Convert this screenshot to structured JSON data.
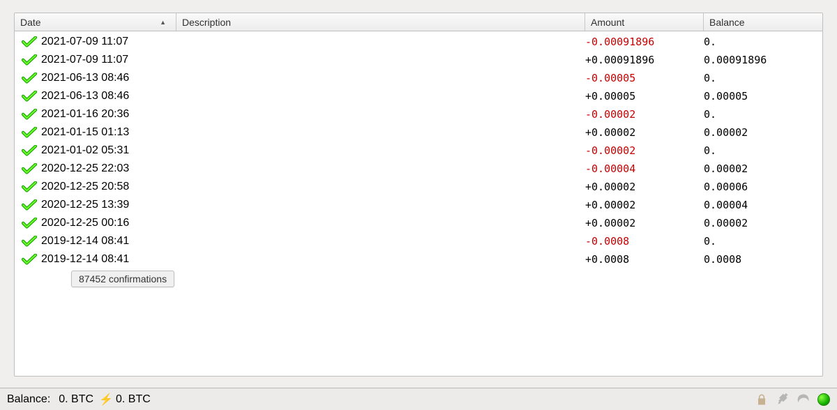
{
  "header": {
    "date": "Date",
    "description": "Description",
    "amount": "Amount",
    "balance": "Balance",
    "sort_indicator": "▲"
  },
  "tooltip": "87452 confirmations",
  "statusbar": {
    "balance_label": "Balance:",
    "balance_value": "0. BTC",
    "lightning_value": "0. BTC"
  },
  "rows": [
    {
      "date": "2021-07-09 11:07",
      "description": "",
      "amount": "-0.00091896",
      "neg": true,
      "balance": "0."
    },
    {
      "date": "2021-07-09 11:07",
      "description": "",
      "amount": "+0.00091896",
      "neg": false,
      "balance": "0.00091896"
    },
    {
      "date": "2021-06-13 08:46",
      "description": "",
      "amount": "-0.00005",
      "neg": true,
      "balance": "0."
    },
    {
      "date": "2021-06-13 08:46",
      "description": "",
      "amount": "+0.00005",
      "neg": false,
      "balance": "0.00005"
    },
    {
      "date": "2021-01-16 20:36",
      "description": "",
      "amount": "-0.00002",
      "neg": true,
      "balance": "0."
    },
    {
      "date": "2021-01-15 01:13",
      "description": "",
      "amount": "+0.00002",
      "neg": false,
      "balance": "0.00002"
    },
    {
      "date": "2021-01-02 05:31",
      "description": "",
      "amount": "-0.00002",
      "neg": true,
      "balance": "0."
    },
    {
      "date": "2020-12-25 22:03",
      "description": "",
      "amount": "-0.00004",
      "neg": true,
      "balance": "0.00002"
    },
    {
      "date": "2020-12-25 20:58",
      "description": "",
      "amount": "+0.00002",
      "neg": false,
      "balance": "0.00006"
    },
    {
      "date": "2020-12-25 13:39",
      "description": "",
      "amount": "+0.00002",
      "neg": false,
      "balance": "0.00004"
    },
    {
      "date": "2020-12-25 00:16",
      "description": "",
      "amount": "+0.00002",
      "neg": false,
      "balance": "0.00002"
    },
    {
      "date": "2019-12-14 08:41",
      "description": "",
      "amount": "-0.0008",
      "neg": true,
      "balance": "0."
    },
    {
      "date": "2019-12-14 08:41",
      "description": "",
      "amount": "+0.0008",
      "neg": false,
      "balance": "0.0008"
    }
  ]
}
